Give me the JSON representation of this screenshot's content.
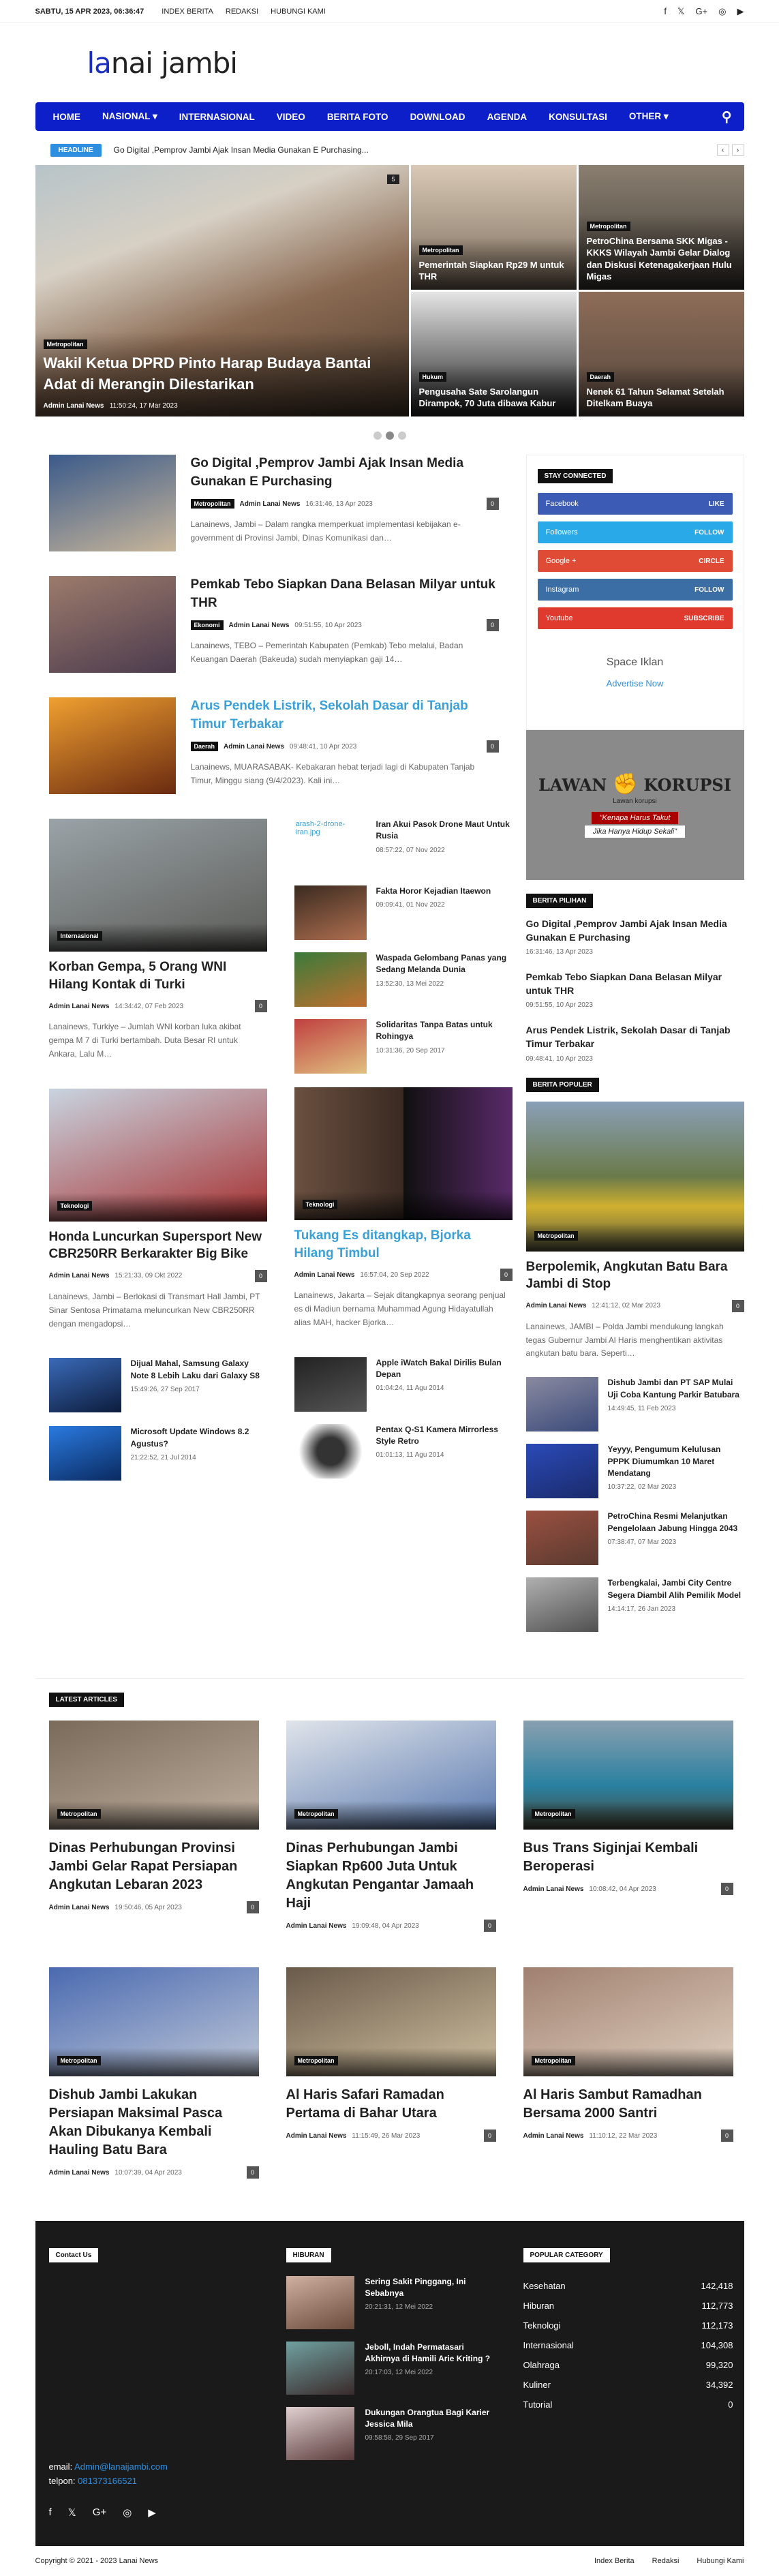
{
  "topbar": {
    "date": "SABTU, 15 APR 2023, 06:36:47",
    "links": [
      "INDEX BERITA",
      "REDAKSI",
      "HUBUNGI KAMI"
    ],
    "social": [
      "f",
      "𝕏",
      "G+",
      "◎",
      "▶"
    ]
  },
  "logo": {
    "part1": "l",
    "accent": "a",
    "part2": "nai jambi"
  },
  "nav": [
    "HOME",
    "NASIONAL ▾",
    "INTERNASIONAL",
    "VIDEO",
    "BERITA FOTO",
    "DOWNLOAD",
    "AGENDA",
    "KONSULTASI",
    "OTHER ▾"
  ],
  "ticker": {
    "label": "HEADLINE",
    "text": "Go Digital ,Pemprov Jambi Ajak Insan Media Gunakan E Purchasing..."
  },
  "hero": {
    "big": {
      "tag": "Metropolitan",
      "title": "Wakil Ketua DPRD Pinto Harap Budaya Bantai Adat di Merangin Dilestarikan",
      "author": "Admin Lanai News",
      "time": "11:50:24, 17 Mar 2023",
      "count": "5"
    },
    "small": [
      {
        "tag": "Metropolitan",
        "title": "Pemerintah Siapkan Rp29 M untuk THR"
      },
      {
        "tag": "Metropolitan",
        "title": "PetroChina Bersama SKK Migas - KKKS Wilayah Jambi Gelar Dialog dan Diskusi Ketenagakerjaan Hulu Migas"
      },
      {
        "tag": "Hukum",
        "title": "Pengusaha Sate Sarolangun Dirampok, 70 Juta dibawa Kabur"
      },
      {
        "tag": "Daerah",
        "title": "Nenek 61 Tahun Selamat Setelah Ditelkam Buaya"
      }
    ]
  },
  "posts": [
    {
      "title": "Go Digital ,Pemprov Jambi Ajak Insan Media Gunakan E Purchasing",
      "cat": "Metropolitan",
      "author": "Admin Lanai News",
      "time": "16:31:46, 13 Apr 2023",
      "count": "0",
      "excerpt": "Lanainews, Jambi – Dalam rangka memperkuat implementasi kebijakan e-government di Provinsi Jambi, Dinas Komunikasi dan…"
    },
    {
      "title": "Pemkab Tebo Siapkan Dana Belasan Milyar untuk THR",
      "cat": "Ekonomi",
      "author": "Admin Lanai News",
      "time": "09:51:55, 10 Apr 2023",
      "count": "0",
      "excerpt": "Lanainews, TEBO – Pemerintah Kabupaten (Pemkab) Tebo melalui, Badan Keuangan Daerah (Bakeuda) sudah menyiapkan gaji 14…"
    },
    {
      "title": "Arus Pendek Listrik, Sekolah Dasar di Tanjab Timur Terbakar",
      "cat": "Daerah",
      "author": "Admin Lanai News",
      "time": "09:48:41, 10 Apr 2023",
      "count": "0",
      "excerpt": "Lanainews, MUARASABAK- Kebakaran hebat terjadi lagi di Kabupaten Tanjab Timur, Minggu siang (9/4/2023). Kali ini…"
    }
  ],
  "cards": [
    {
      "tag": "Internasional",
      "title": "Korban Gempa, 5 Orang WNI Hilang Kontak di Turki",
      "author": "Admin Lanai News",
      "time": "14:34:42, 07 Feb 2023",
      "count": "0",
      "excerpt": "Lanainews, Turkiye – Jumlah WNI korban luka akibat gempa M 7 di Turki bertambah. Duta Besar RI untuk Ankara, Lalu M…"
    },
    {
      "tag": "Teknologi",
      "title": "Honda Luncurkan Supersport New CBR250RR Berkarakter Big Bike",
      "author": "Admin Lanai News",
      "time": "15:21:33, 09 Okt 2022",
      "count": "0",
      "excerpt": "Lanainews, Jambi – Berlokasi di Transmart Hall Jambi, PT Sinar Sentosa Primatama meluncurkan New CBR250RR dengan mengadopsi…"
    },
    {
      "tag": "Teknologi",
      "title": "Tukang Es ditangkap, Bjorka Hilang Timbul",
      "author": "Admin Lanai News",
      "time": "16:57:04, 20 Sep 2022",
      "count": "0",
      "excerpt": "Lanainews, Jakarta – Sejak ditangkapnya seorang penjual es di Madiun bernama Muhammad Agung Hidayatullah alias MAH, hacker Bjorka…"
    }
  ],
  "minis_a": [
    {
      "title": "Iran Akui Pasok Drone Maut Untuk Rusia",
      "time": "08:57:22, 07 Nov 2022",
      "alt": "arash-2-drone-iran.jpg"
    },
    {
      "title": "Fakta Horor Kejadian Itaewon",
      "time": "09:09:41, 01 Nov 2022"
    },
    {
      "title": "Waspada Gelombang Panas yang Sedang Melanda Dunia",
      "time": "13:52:30, 13 Mei 2022"
    },
    {
      "title": "Solidaritas Tanpa Batas untuk Rohingya",
      "time": "10:31:36, 20 Sep 2017"
    }
  ],
  "minis_b": [
    {
      "title": "Dijual Mahal, Samsung Galaxy Note 8 Lebih Laku dari Galaxy S8",
      "time": "15:49:26, 27 Sep 2017"
    },
    {
      "title": "Microsoft Update Windows 8.2 Agustus?",
      "time": "21:22:52, 21 Jul 2014"
    }
  ],
  "minis_c": [
    {
      "title": "Apple iWatch Bakal Dirilis Bulan Depan",
      "time": "01:04:24, 11 Agu 2014"
    },
    {
      "title": "Pentax Q-S1 Kamera Mirrorless Style Retro",
      "time": "01:01:13, 11 Agu 2014"
    }
  ],
  "sidebar": {
    "stay": "STAY CONNECTED",
    "social": [
      {
        "name": "Facebook",
        "act": "LIKE",
        "color": "#3b5bb5"
      },
      {
        "name": "Followers",
        "act": "FOLLOW",
        "color": "#29a9e8"
      },
      {
        "name": "Google +",
        "act": "CIRCLE",
        "color": "#e04b35"
      },
      {
        "name": "Instagram",
        "act": "FOLLOW",
        "color": "#3b6ea5"
      },
      {
        "name": "Youtube",
        "act": "SUBSCRIBE",
        "color": "#e03a2e"
      }
    ],
    "iklan": "Space Iklan",
    "iklan_link": "Advertise Now",
    "banner": {
      "left": "LAWAN",
      "right": "KORUPSI",
      "small": "Lawan korupsi",
      "quote1": "\"Kenapa Harus Takut",
      "quote2": "Jika Hanya Hidup Sekali\""
    },
    "pilihan_title": "BERITA PILIHAN",
    "pilihan": [
      {
        "title": "Go Digital ,Pemprov Jambi Ajak Insan Media Gunakan E Purchasing",
        "time": "16:31:46, 13 Apr 2023"
      },
      {
        "title": "Pemkab Tebo Siapkan Dana Belasan Milyar untuk THR",
        "time": "09:51:55, 10 Apr 2023"
      },
      {
        "title": "Arus Pendek Listrik, Sekolah Dasar di Tanjab Timur Terbakar",
        "time": "09:48:41, 10 Apr 2023"
      }
    ],
    "populer_title": "BERITA POPULER",
    "populer_main": {
      "tag": "Metropolitan",
      "title": "Berpolemik, Angkutan Batu Bara Jambi di Stop",
      "author": "Admin Lanai News",
      "time": "12:41:12, 02 Mar 2023",
      "count": "0",
      "excerpt": "Lanainews, JAMBI – Polda Jambi mendukung langkah tegas Gubernur Jambi Al Haris menghentikan aktivitas angkutan batu bara. Seperti…"
    },
    "populer": [
      {
        "title": "Dishub Jambi dan PT SAP Mulai Uji Coba Kantung Parkir Batubara",
        "time": "14:49:45, 11 Feb 2023"
      },
      {
        "title": "Yeyyy, Pengumum Kelulusan PPPK Diumumkan 10 Maret Mendatang",
        "time": "10:37:22, 02 Mar 2023"
      },
      {
        "title": "PetroChina Resmi Melanjutkan Pengelolaan Jabung Hingga 2043",
        "time": "07:38:47, 07 Mar 2023"
      },
      {
        "title": "Terbengkalai, Jambi City Centre Segera Diambil Alih Pemilik Model",
        "time": "14:14:17, 26 Jan 2023"
      }
    ]
  },
  "latest_title": "LATEST ARTICLES",
  "latest": [
    {
      "tag": "Metropolitan",
      "title": "Dinas Perhubungan Provinsi Jambi Gelar Rapat Persiapan Angkutan Lebaran 2023",
      "author": "Admin Lanai News",
      "time": "19:50:46, 05 Apr 2023",
      "count": "0"
    },
    {
      "tag": "Metropolitan",
      "title": "Dinas Perhubungan Jambi Siapkan Rp600 Juta Untuk Angkutan Pengantar Jamaah Haji",
      "author": "Admin Lanai News",
      "time": "19:09:48, 04 Apr 2023",
      "count": "0"
    },
    {
      "tag": "Metropolitan",
      "title": "Bus Trans Siginjai Kembali Beroperasi",
      "author": "Admin Lanai News",
      "time": "10:08:42, 04 Apr 2023",
      "count": "0"
    },
    {
      "tag": "Metropolitan",
      "title": "Dishub Jambi Lakukan Persiapan Maksimal Pasca Akan Dibukanya Kembali Hauling Batu Bara",
      "author": "Admin Lanai News",
      "time": "10:07:39, 04 Apr 2023",
      "count": "0"
    },
    {
      "tag": "Metropolitan",
      "title": "Al Haris Safari Ramadan Pertama di Bahar Utara",
      "author": "Admin Lanai News",
      "time": "11:15:49, 26 Mar 2023",
      "count": "0"
    },
    {
      "tag": "Metropolitan",
      "title": "Al Haris Sambut Ramadhan Bersama 2000 Santri",
      "author": "Admin Lanai News",
      "time": "11:10:12, 22 Mar 2023",
      "count": "0"
    }
  ],
  "footer": {
    "contact_title": "Contact Us",
    "email_label": "email:",
    "email": "Admin@lanaijambi.com",
    "tel_label": "telpon:",
    "tel": "081373166521",
    "hiburan_title": "HIBURAN",
    "hiburan": [
      {
        "title": "Sering Sakit Pinggang, Ini Sebabnya",
        "time": "20:21:31, 12 Mei 2022"
      },
      {
        "title": "Jeboll, Indah Permatasari Akhirnya di Hamili Arie Kriting ?",
        "time": "20:17:03, 12 Mei 2022"
      },
      {
        "title": "Dukungan Orangtua Bagi Karier Jessica Mila",
        "time": "09:58:58, 29 Sep 2017"
      }
    ],
    "cat_title": "POPULAR CATEGORY",
    "cats": [
      {
        "n": "Kesehatan",
        "c": "142,418"
      },
      {
        "n": "Hiburan",
        "c": "112,773"
      },
      {
        "n": "Teknologi",
        "c": "112,173"
      },
      {
        "n": "Internasional",
        "c": "104,308"
      },
      {
        "n": "Olahraga",
        "c": "99,320"
      },
      {
        "n": "Kuliner",
        "c": "34,392"
      },
      {
        "n": "Tutorial",
        "c": "0"
      }
    ],
    "social": [
      "f",
      "𝕏",
      "G+",
      "◎",
      "▶"
    ]
  },
  "bottom": {
    "copy": "Copyright © 2021 - 2023 Lanai News",
    "links": [
      "Index Berita",
      "Redaksi",
      "Hubungi Kami"
    ]
  }
}
